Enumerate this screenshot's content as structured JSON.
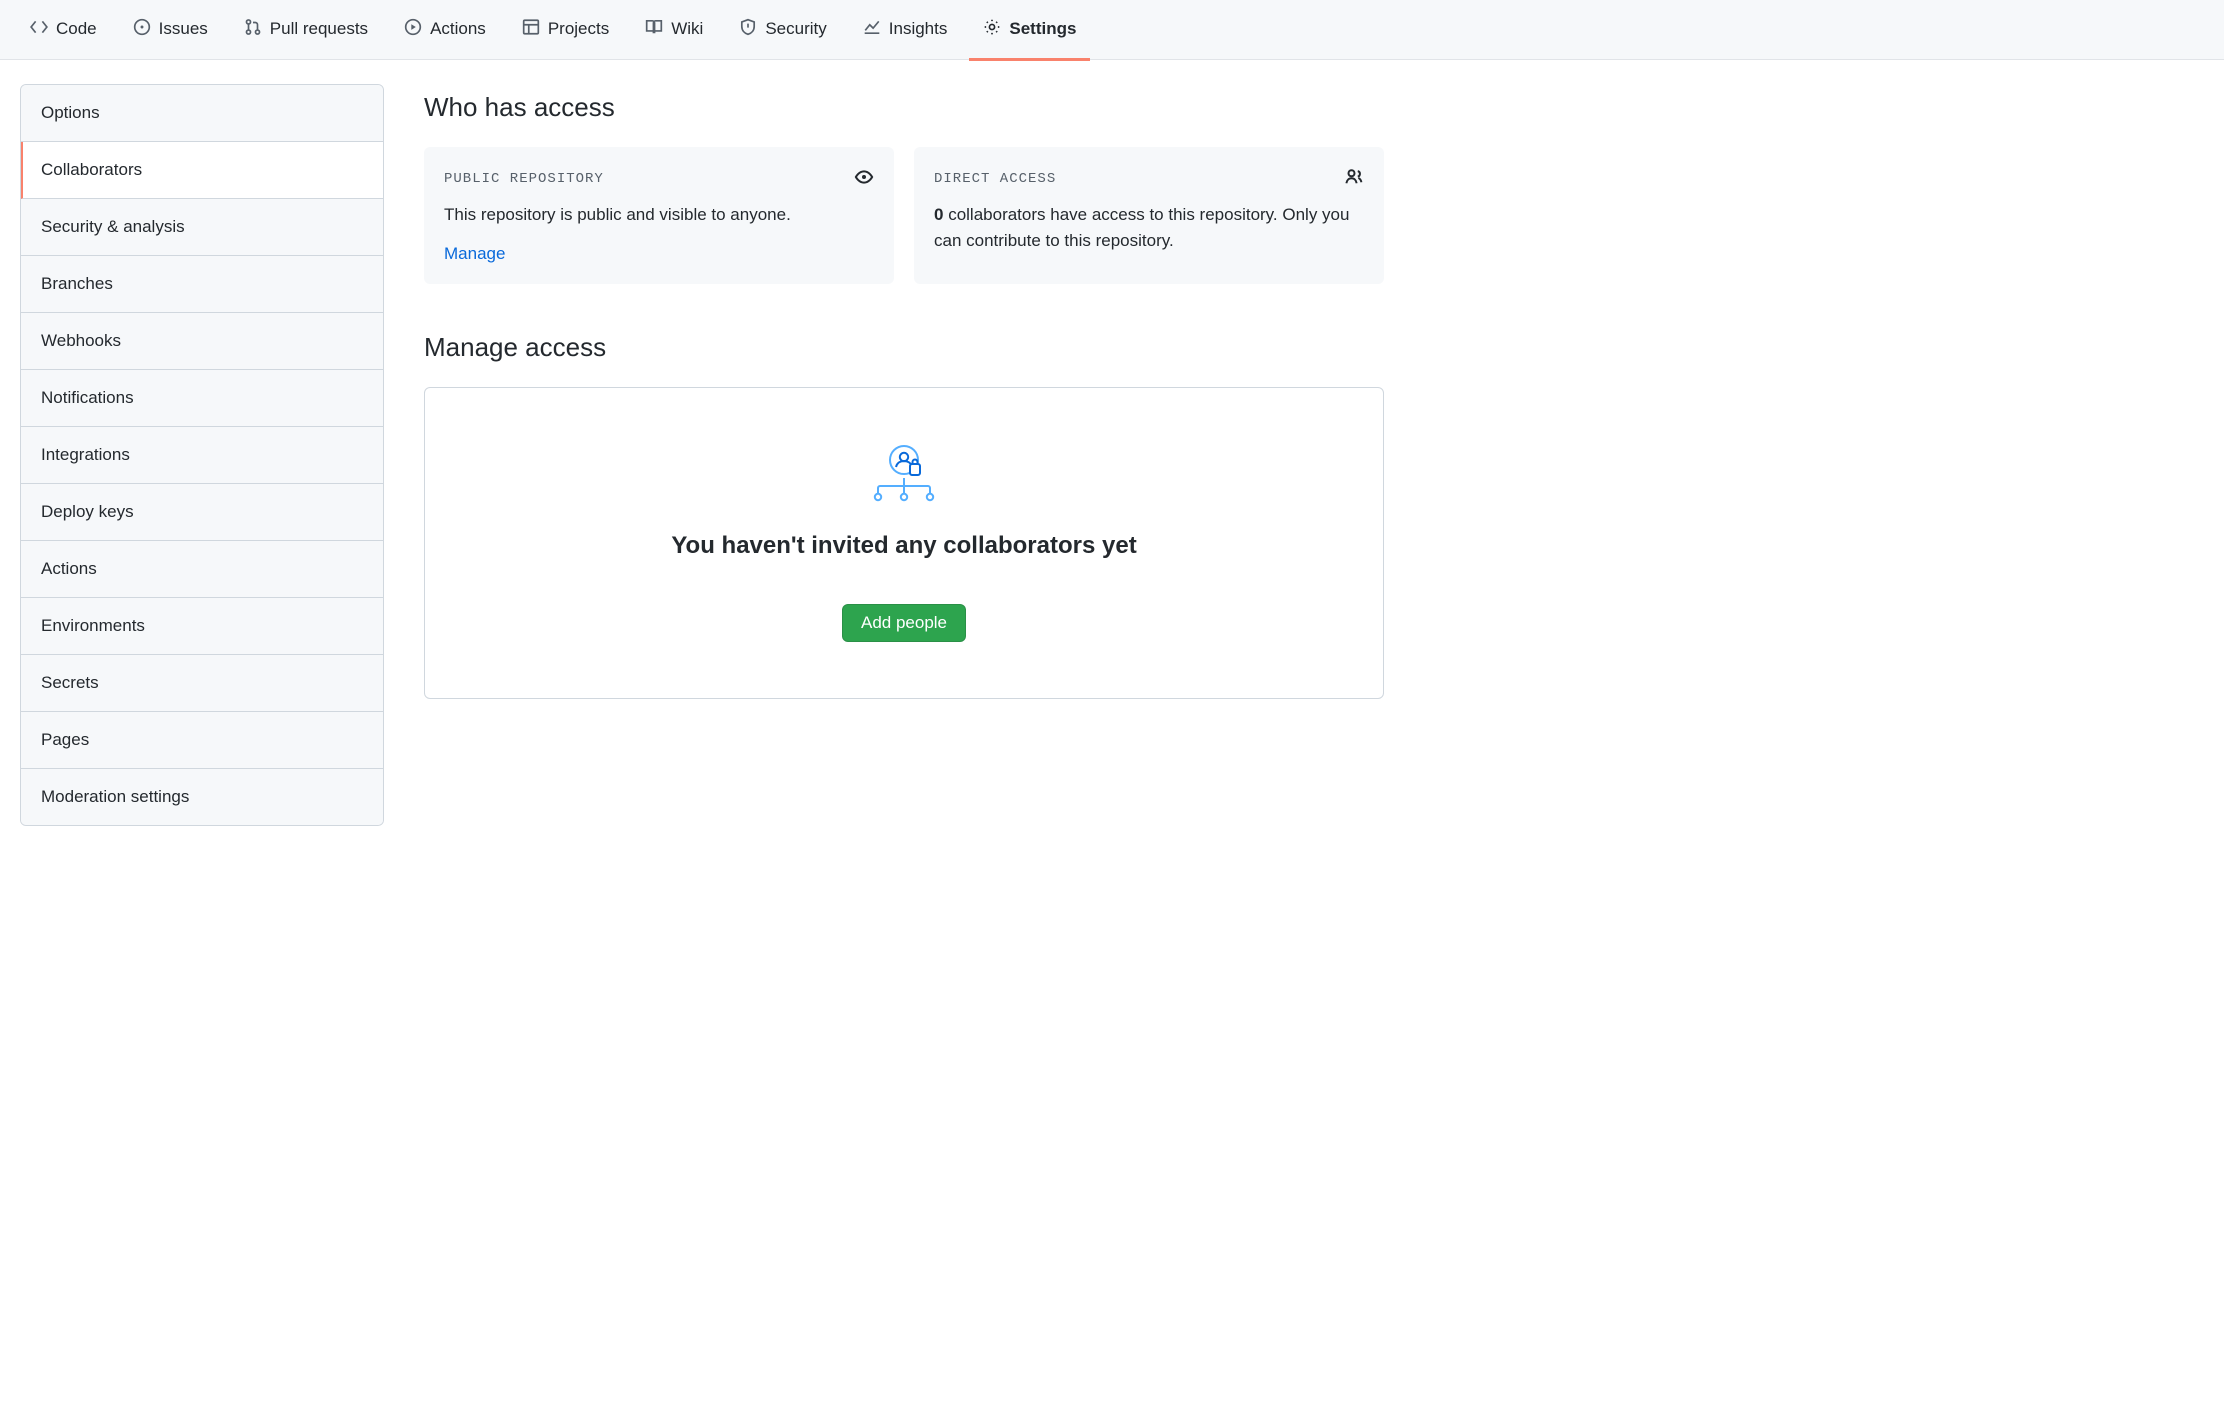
{
  "topnav": {
    "items": [
      {
        "label": "Code",
        "icon": "code-icon"
      },
      {
        "label": "Issues",
        "icon": "issue-icon"
      },
      {
        "label": "Pull requests",
        "icon": "pr-icon"
      },
      {
        "label": "Actions",
        "icon": "play-icon"
      },
      {
        "label": "Projects",
        "icon": "project-icon"
      },
      {
        "label": "Wiki",
        "icon": "book-icon"
      },
      {
        "label": "Security",
        "icon": "shield-icon"
      },
      {
        "label": "Insights",
        "icon": "graph-icon"
      },
      {
        "label": "Settings",
        "icon": "gear-icon"
      }
    ],
    "selected": "Settings"
  },
  "sidenav": {
    "items": [
      "Options",
      "Collaborators",
      "Security & analysis",
      "Branches",
      "Webhooks",
      "Notifications",
      "Integrations",
      "Deploy keys",
      "Actions",
      "Environments",
      "Secrets",
      "Pages",
      "Moderation settings"
    ],
    "selected": "Collaborators"
  },
  "access": {
    "heading": "Who has access",
    "public_card": {
      "label": "PUBLIC REPOSITORY",
      "text": "This repository is public and visible to anyone.",
      "manage_link": "Manage"
    },
    "direct_card": {
      "label": "DIRECT ACCESS",
      "count": "0",
      "text_rest": " collaborators have access to this repository. Only you can contribute to this repository."
    }
  },
  "manage": {
    "heading": "Manage access",
    "empty_title": "You haven't invited any collaborators yet",
    "add_button": "Add people"
  }
}
